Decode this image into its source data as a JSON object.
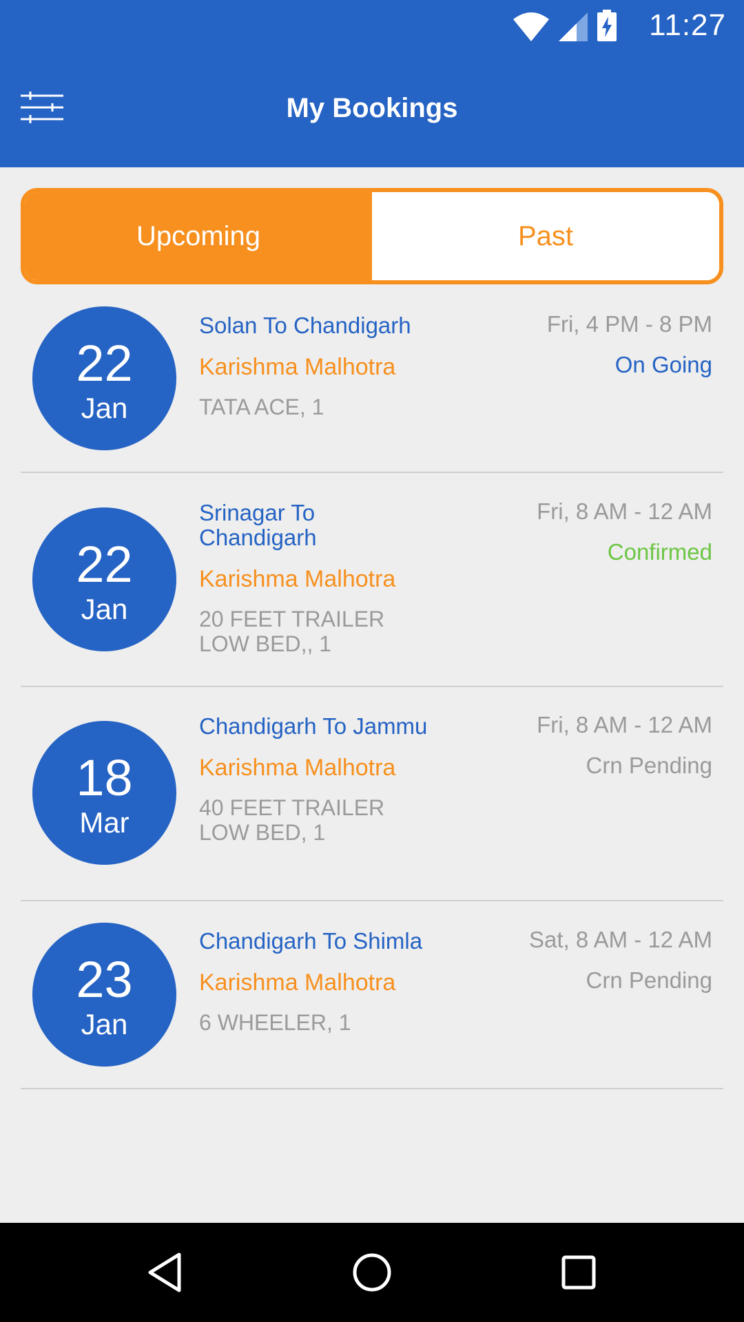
{
  "status_bar": {
    "time": "11:27"
  },
  "header": {
    "title": "My Bookings",
    "menu_icon": "filter-sliders-icon"
  },
  "tabs": [
    {
      "label": "Upcoming",
      "active": true
    },
    {
      "label": "Past",
      "active": false
    }
  ],
  "bookings": [
    {
      "day": "22",
      "month": "Jan",
      "route": "Solan To Chandigarh",
      "name": "Karishma Malhotra",
      "vehicle": "TATA ACE, 1",
      "time": "Fri, 4 PM - 8 PM",
      "status": "On Going",
      "status_color": "#2563c4"
    },
    {
      "day": "22",
      "month": "Jan",
      "route": "Srinagar To Chandigarh",
      "name": "Karishma Malhotra",
      "vehicle": "20 FEET TRAILER LOW BED,, 1",
      "time": "Fri, 8 AM - 12 AM",
      "status": "Confirmed",
      "status_color": "#6cc644"
    },
    {
      "day": "18",
      "month": "Mar",
      "route": "Chandigarh To Jammu",
      "name": "Karishma Malhotra",
      "vehicle": "40 FEET TRAILER LOW BED, 1",
      "time": "Fri, 8 AM - 12 AM",
      "status": "Crn Pending",
      "status_color": "#9a9a9a"
    },
    {
      "day": "23",
      "month": "Jan",
      "route": "Chandigarh To Shimla",
      "name": "Karishma Malhotra",
      "vehicle": "6 WHEELER, 1",
      "time": "Sat, 8 AM - 12 AM",
      "status": "Crn Pending",
      "status_color": "#9a9a9a"
    }
  ],
  "colors": {
    "primary": "#2563c4",
    "accent": "#f7901e",
    "background": "#eeeeee"
  },
  "nav": {
    "back_icon": "back-triangle-icon",
    "home_icon": "home-circle-icon",
    "recents_icon": "recents-square-icon"
  }
}
